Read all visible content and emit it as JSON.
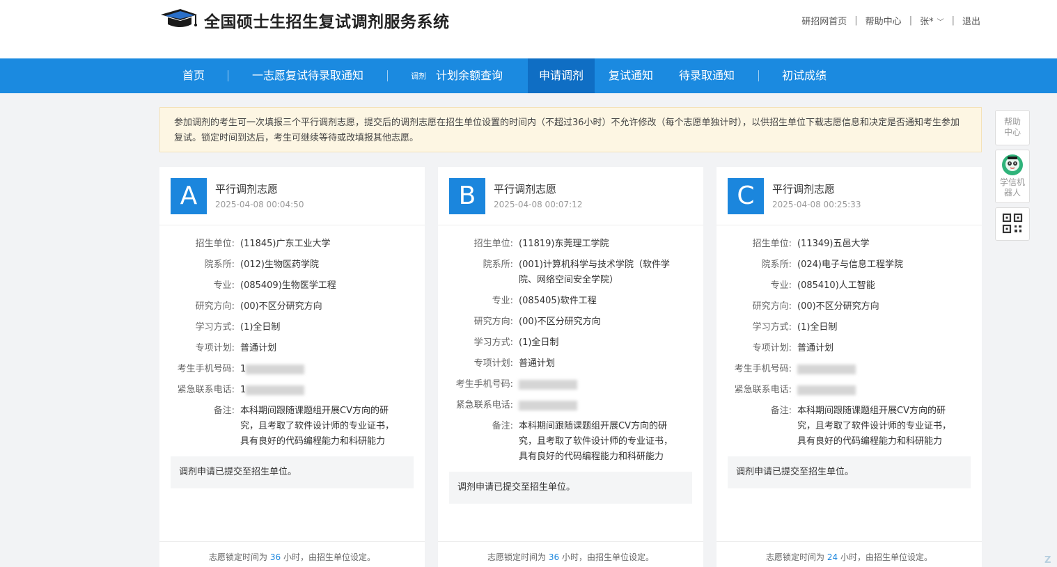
{
  "header": {
    "title": "全国硕士生招生复试调剂服务系统",
    "links": {
      "home": "研招网首页",
      "help": "帮助中心",
      "user": "张*",
      "logout": "退出"
    }
  },
  "nav": {
    "home": "首页",
    "first_choice": "一志愿复试待录取通知",
    "adjust_prefix": "调剂",
    "quota": "计划余额查询",
    "apply": "申请调剂",
    "retest": "复试通知",
    "admit": "待录取通知",
    "scores": "初试成绩"
  },
  "notice": "参加调剂的考生可一次填报三个平行调剂志愿，提交后的调剂志愿在招生单位设置的时间内（不超过36小时）不允许修改（每个志愿单独计时），以供招生单位下载志愿信息和决定是否通知考生参加复试。锁定时间到达后，考生可继续等待或改填报其他志愿。",
  "labels": {
    "unit": "招生单位:",
    "dept": "院系所:",
    "major": "专业:",
    "direction": "研究方向:",
    "mode": "学习方式:",
    "plan": "专项计划:",
    "phone": "考生手机号码:",
    "emergency": "紧急联系电话:",
    "remark": "备注:"
  },
  "cards": [
    {
      "letter": "A",
      "title": "平行调剂志愿",
      "time": "2025-04-08 00:04:50",
      "unit": "(11845)广东工业大学",
      "dept": "(012)生物医药学院",
      "major": "(085409)生物医学工程",
      "direction": "(00)不区分研究方向",
      "mode": "(1)全日制",
      "plan": "普通计划",
      "phone": "1",
      "emergency": "1",
      "remark": "本科期间跟随课题组开展CV方向的研究，且考取了软件设计师的专业证书，具有良好的代码编程能力和科研能力",
      "status": "调剂申请已提交至招生单位。",
      "foot_pre": "志愿锁定时间为",
      "hours": "36",
      "foot_post": "小时，由招生单位设定。"
    },
    {
      "letter": "B",
      "title": "平行调剂志愿",
      "time": "2025-04-08 00:07:12",
      "unit": "(11819)东莞理工学院",
      "dept": "(001)计算机科学与技术学院（软件学院、网络空间安全学院）",
      "major": "(085405)软件工程",
      "direction": "(00)不区分研究方向",
      "mode": "(1)全日制",
      "plan": "普通计划",
      "phone": "",
      "emergency": "",
      "remark": "本科期间跟随课题组开展CV方向的研究，且考取了软件设计师的专业证书，具有良好的代码编程能力和科研能力",
      "status": "调剂申请已提交至招生单位。",
      "foot_pre": "志愿锁定时间为",
      "hours": "36",
      "foot_post": "小时，由招生单位设定。"
    },
    {
      "letter": "C",
      "title": "平行调剂志愿",
      "time": "2025-04-08 00:25:33",
      "unit": "(11349)五邑大学",
      "dept": "(024)电子与信息工程学院",
      "major": "(085410)人工智能",
      "direction": "(00)不区分研究方向",
      "mode": "(1)全日制",
      "plan": "普通计划",
      "phone": "",
      "emergency": "",
      "remark": "本科期间跟随课题组开展CV方向的研究，且考取了软件设计师的专业证书，具有良好的代码编程能力和科研能力",
      "status": "调剂申请已提交至招生单位。",
      "foot_pre": "志愿锁定时间为",
      "hours": "24",
      "foot_post": "小时，由招生单位设定。"
    }
  ],
  "side": {
    "help": "帮助中心",
    "robot": "学信机器人"
  },
  "colors": {
    "nav": "#1b8ae0",
    "nav_active": "#0f6ec4",
    "badge": "#1b86dd",
    "notice_bg": "#fdf6e3"
  },
  "icons": {
    "logo": "mortarboard-icon",
    "qr": "qr-code-icon",
    "robot": "robot-icon",
    "user_menu": "chevron-down-icon"
  }
}
